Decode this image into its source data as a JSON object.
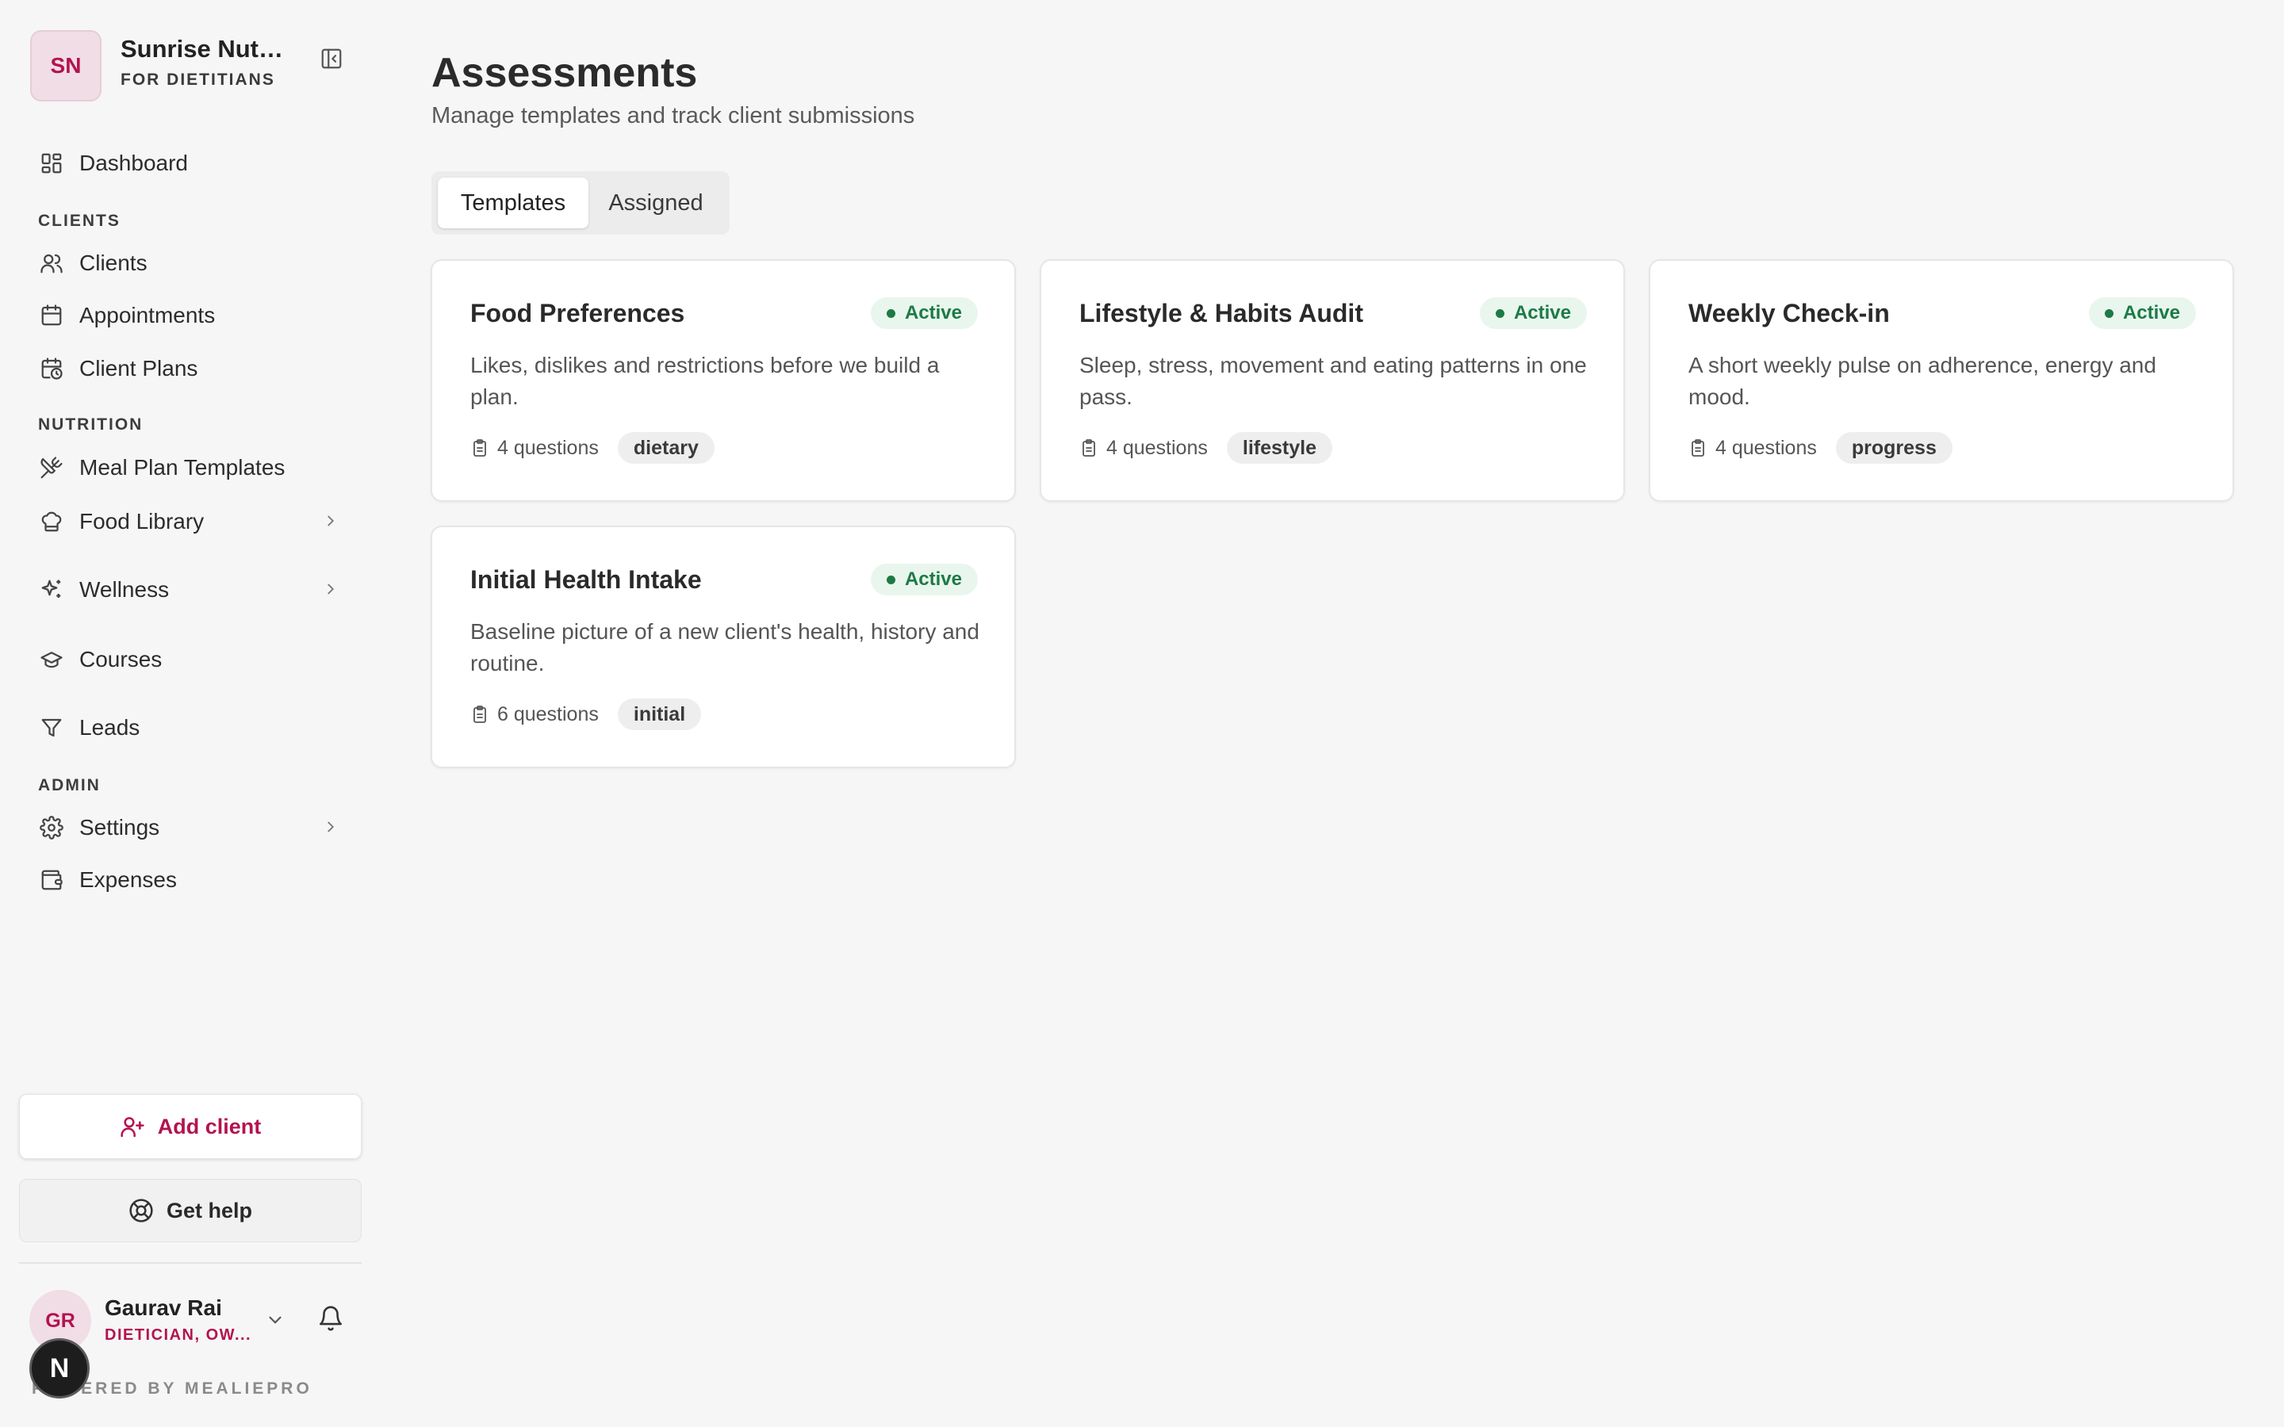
{
  "org": {
    "initials": "SN",
    "name": "Sunrise Nutrition",
    "subtitle": "FOR DIETITIANS"
  },
  "nav": {
    "dashboard": "Dashboard",
    "clients_section": "CLIENTS",
    "clients": "Clients",
    "appointments": "Appointments",
    "client_plans": "Client Plans",
    "nutrition_section": "NUTRITION",
    "meal_plan_templates": "Meal Plan Templates",
    "food_library": "Food Library",
    "wellness": "Wellness",
    "courses": "Courses",
    "leads": "Leads",
    "admin_section": "ADMIN",
    "settings": "Settings",
    "expenses": "Expenses"
  },
  "actions": {
    "add_client": "Add client",
    "get_help": "Get help"
  },
  "user": {
    "initials": "GR",
    "name": "Gaurav Rai",
    "role": "DIETICIAN, OW..."
  },
  "footer": {
    "powered": "POWERED BY MEALIEPRO",
    "badge": "N"
  },
  "page": {
    "title": "Assessments",
    "subtitle": "Manage templates and track client submissions"
  },
  "tabs": [
    {
      "label": "Templates",
      "active": true
    },
    {
      "label": "Assigned",
      "active": false
    }
  ],
  "cards": [
    {
      "title": "Food Preferences",
      "status": "Active",
      "description": "Likes, dislikes and restrictions before we build a plan.",
      "questions": "4 questions",
      "tag": "dietary"
    },
    {
      "title": "Lifestyle & Habits Audit",
      "status": "Active",
      "description": "Sleep, stress, movement and eating patterns in one pass.",
      "questions": "4 questions",
      "tag": "lifestyle"
    },
    {
      "title": "Weekly Check-in",
      "status": "Active",
      "description": "A short weekly pulse on adherence, energy and mood.",
      "questions": "4 questions",
      "tag": "progress"
    },
    {
      "title": "Initial Health Intake",
      "status": "Active",
      "description": "Baseline picture of a new client's health, history and routine.",
      "questions": "6 questions",
      "tag": "initial"
    }
  ],
  "colors": {
    "accent": "#b3134f",
    "active_green": "#1d7a45",
    "active_bg": "#e9f6ee",
    "page_bg": "#f6f6f6"
  }
}
